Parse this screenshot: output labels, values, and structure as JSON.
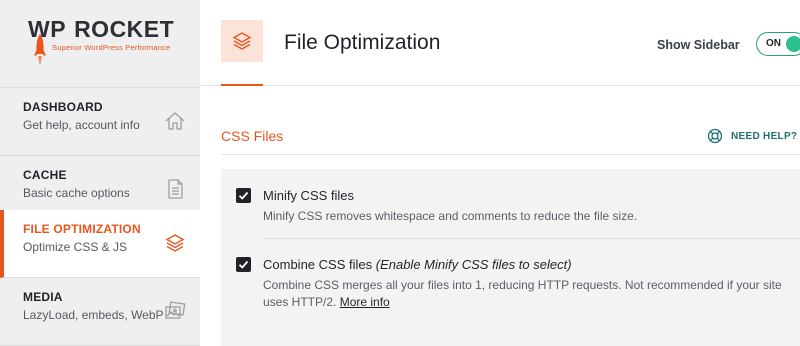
{
  "brand": {
    "wp": "WP",
    "rocket": "ROCKET",
    "tagline": "Superior WordPress Performance",
    "accent": "#e8561e"
  },
  "sidebar": {
    "items": [
      {
        "title": "DASHBOARD",
        "subtitle": "Get help, account info",
        "icon": "home-icon",
        "active": false
      },
      {
        "title": "CACHE",
        "subtitle": "Basic cache options",
        "icon": "document-icon",
        "active": false
      },
      {
        "title": "FILE OPTIMIZATION",
        "subtitle": "Optimize CSS & JS",
        "icon": "layers-icon",
        "active": true
      },
      {
        "title": "MEDIA",
        "subtitle": "LazyLoad, embeds, WebP",
        "icon": "images-icon",
        "active": false
      }
    ]
  },
  "header": {
    "title": "File Optimization",
    "show_sidebar_label": "Show Sidebar",
    "toggle_label": "ON",
    "toggle_color": "#2cbf8f"
  },
  "section": {
    "title": "CSS Files",
    "help_label": "NEED HELP?"
  },
  "options": [
    {
      "label": "Minify CSS files",
      "label_note": "",
      "checked": true,
      "description": "Minify CSS removes whitespace and comments to reduce the file size.",
      "link": ""
    },
    {
      "label": "Combine CSS files",
      "label_note": "(Enable Minify CSS files to select)",
      "checked": true,
      "description": "Combine CSS merges all your files into 1, reducing HTTP requests. Not recommended if your site uses HTTP/2.",
      "link": "More info"
    }
  ]
}
